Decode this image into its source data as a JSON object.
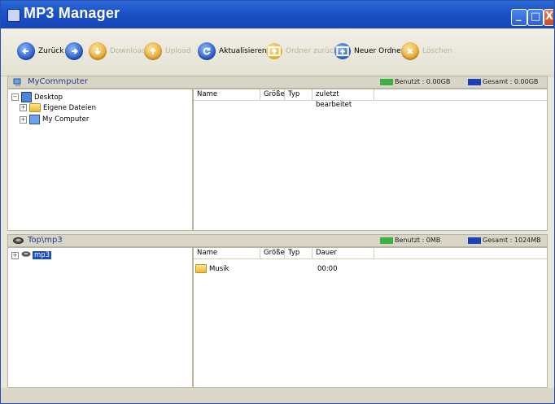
{
  "window": {
    "title": "MP3 Manager",
    "min_glyph": "_",
    "max_glyph": "□",
    "close_glyph": "X"
  },
  "toolbar": {
    "back": "Zurück",
    "forward": "",
    "download": "Download",
    "upload": "Upload",
    "refresh": "Aktualisieren",
    "folder_up": "Ordner zurück",
    "new_folder": "Neuer Ordner",
    "delete": "Löschen"
  },
  "top_panel": {
    "title": "MyCommputer",
    "used_label": "Benutzt : 0.00GB",
    "total_label": "Gesamt : 0.00GB",
    "used_color": "#3cb043",
    "total_color": "#1d3fb8",
    "tree": {
      "root": "Desktop",
      "children": [
        "Eigene Dateien",
        "My Computer"
      ]
    },
    "columns": [
      "Name",
      "Größe",
      "Typ",
      "zuletzt bearbeitet"
    ]
  },
  "bottom_panel": {
    "title": "Top\\mp3",
    "used_label": "Benutzt : 0MB",
    "total_label": "Gesamt : 1024MB",
    "used_color": "#3cb043",
    "total_color": "#1d3fb8",
    "tree": {
      "root": "mp3"
    },
    "columns": [
      "Name",
      "Größe",
      "Typ",
      "Dauer"
    ],
    "rows": [
      {
        "name": "Musik",
        "size": "",
        "type": "",
        "duration": "00:00"
      }
    ]
  }
}
